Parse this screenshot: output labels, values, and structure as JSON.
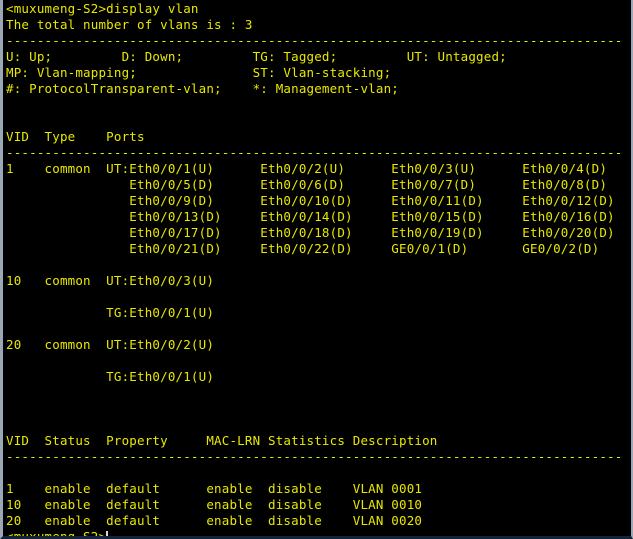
{
  "terminal": {
    "colors": {
      "background": "#000000",
      "foreground": "#e8e800",
      "border_left": "#9aa7b4",
      "border_right": "#9aa7b4",
      "border_bottom": "#12233a",
      "cursor": "#d8d8d8"
    },
    "prompt": "<muxumeng-S2>",
    "command": "display vlan",
    "cursor_visible": true,
    "lines": [
      "<muxumeng-S2>display vlan",
      "The total number of vlans is : 3",
      "--------------------------------------------------------------------------------",
      "U: Up;         D: Down;         TG: Tagged;         UT: Untagged;",
      "MP: Vlan-mapping;               ST: Vlan-stacking;",
      "#: ProtocolTransparent-vlan;    *: Management-vlan;",
      "",
      "",
      "VID  Type    Ports",
      "--------------------------------------------------------------------------------",
      "1    common  UT:Eth0/0/1(U)      Eth0/0/2(U)      Eth0/0/3(U)      Eth0/0/4(D)",
      "                Eth0/0/5(D)      Eth0/0/6(D)      Eth0/0/7(D)      Eth0/0/8(D)",
      "                Eth0/0/9(D)      Eth0/0/10(D)     Eth0/0/11(D)     Eth0/0/12(D)",
      "                Eth0/0/13(D)     Eth0/0/14(D)     Eth0/0/15(D)     Eth0/0/16(D)",
      "                Eth0/0/17(D)     Eth0/0/18(D)     Eth0/0/19(D)     Eth0/0/20(D)",
      "                Eth0/0/21(D)     Eth0/0/22(D)     GE0/0/1(D)       GE0/0/2(D)",
      "",
      "10   common  UT:Eth0/0/3(U)",
      "",
      "             TG:Eth0/0/1(U)",
      "",
      "20   common  UT:Eth0/0/2(U)",
      "",
      "             TG:Eth0/0/1(U)",
      "",
      "",
      "",
      "VID  Status  Property     MAC-LRN Statistics Description",
      "--------------------------------------------------------------------------------",
      "",
      "1    enable  default      enable  disable    VLAN 0001",
      "10   enable  default      enable  disable    VLAN 0010",
      "20   enable  default      enable  disable    VLAN 0020",
      "<muxumeng-S2>"
    ]
  },
  "session": {
    "device_name": "muxumeng-S2",
    "command_executed": "display vlan",
    "total_vlans_text": "The total number of vlans is : 3",
    "total_vlans": 3
  },
  "legend": {
    "title": "",
    "entries": [
      {
        "code": "U",
        "meaning": "Up"
      },
      {
        "code": "D",
        "meaning": "Down"
      },
      {
        "code": "TG",
        "meaning": "Tagged"
      },
      {
        "code": "UT",
        "meaning": "Untagged"
      },
      {
        "code": "MP",
        "meaning": "Vlan-mapping"
      },
      {
        "code": "ST",
        "meaning": "Vlan-stacking"
      },
      {
        "code": "#",
        "meaning": "ProtocolTransparent-vlan"
      },
      {
        "code": "*",
        "meaning": "Management-vlan"
      }
    ]
  },
  "ports_table": {
    "headers": [
      "VID",
      "Type",
      "Ports"
    ],
    "rows": [
      {
        "vid": "1",
        "type": "common",
        "port_groups": [
          {
            "tag": "UT:",
            "ports": [
              "Eth0/0/1(U)",
              "Eth0/0/2(U)",
              "Eth0/0/3(U)",
              "Eth0/0/4(D)",
              "Eth0/0/5(D)",
              "Eth0/0/6(D)",
              "Eth0/0/7(D)",
              "Eth0/0/8(D)",
              "Eth0/0/9(D)",
              "Eth0/0/10(D)",
              "Eth0/0/11(D)",
              "Eth0/0/12(D)",
              "Eth0/0/13(D)",
              "Eth0/0/14(D)",
              "Eth0/0/15(D)",
              "Eth0/0/16(D)",
              "Eth0/0/17(D)",
              "Eth0/0/18(D)",
              "Eth0/0/19(D)",
              "Eth0/0/20(D)",
              "Eth0/0/21(D)",
              "Eth0/0/22(D)",
              "GE0/0/1(D)",
              "GE0/0/2(D)"
            ]
          }
        ]
      },
      {
        "vid": "10",
        "type": "common",
        "port_groups": [
          {
            "tag": "UT:",
            "ports": [
              "Eth0/0/3(U)"
            ]
          },
          {
            "tag": "TG:",
            "ports": [
              "Eth0/0/1(U)"
            ]
          }
        ]
      },
      {
        "vid": "20",
        "type": "common",
        "port_groups": [
          {
            "tag": "UT:",
            "ports": [
              "Eth0/0/2(U)"
            ]
          },
          {
            "tag": "TG:",
            "ports": [
              "Eth0/0/1(U)"
            ]
          }
        ]
      }
    ]
  },
  "property_table": {
    "headers": [
      "VID",
      "Status",
      "Property",
      "MAC-LRN",
      "Statistics",
      "Description"
    ],
    "rows": [
      {
        "vid": "1",
        "status": "enable",
        "property": "default",
        "mac_lrn": "enable",
        "statistics": "disable",
        "description": "VLAN 0001"
      },
      {
        "vid": "10",
        "status": "enable",
        "property": "default",
        "mac_lrn": "enable",
        "statistics": "disable",
        "description": "VLAN 0010"
      },
      {
        "vid": "20",
        "status": "enable",
        "property": "default",
        "mac_lrn": "enable",
        "statistics": "disable",
        "description": "VLAN 0020"
      }
    ]
  }
}
